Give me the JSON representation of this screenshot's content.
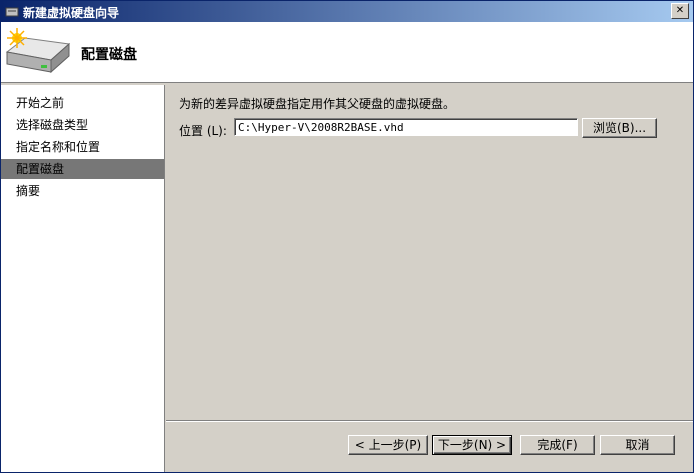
{
  "window": {
    "title": "新建虚拟硬盘向导",
    "close_glyph": "✕"
  },
  "header": {
    "title": "配置磁盘",
    "icon": "hard-disk-icon"
  },
  "sidebar": {
    "items": [
      {
        "label": "开始之前"
      },
      {
        "label": "选择磁盘类型"
      },
      {
        "label": "指定名称和位置"
      },
      {
        "label": "配置磁盘",
        "active": true
      },
      {
        "label": "摘要"
      }
    ]
  },
  "main": {
    "instruction": "为新的差异虚拟硬盘指定用作其父硬盘的虚拟硬盘。",
    "location_label": "位置 (L):",
    "location_value": "C:\\Hyper-V\\2008R2BASE.vhd",
    "browse_label": "浏览(B)..."
  },
  "footer": {
    "back_label": "< 上一步(P)",
    "next_label": "下一步(N) >",
    "finish_label": "完成(F)",
    "cancel_label": "取消"
  }
}
